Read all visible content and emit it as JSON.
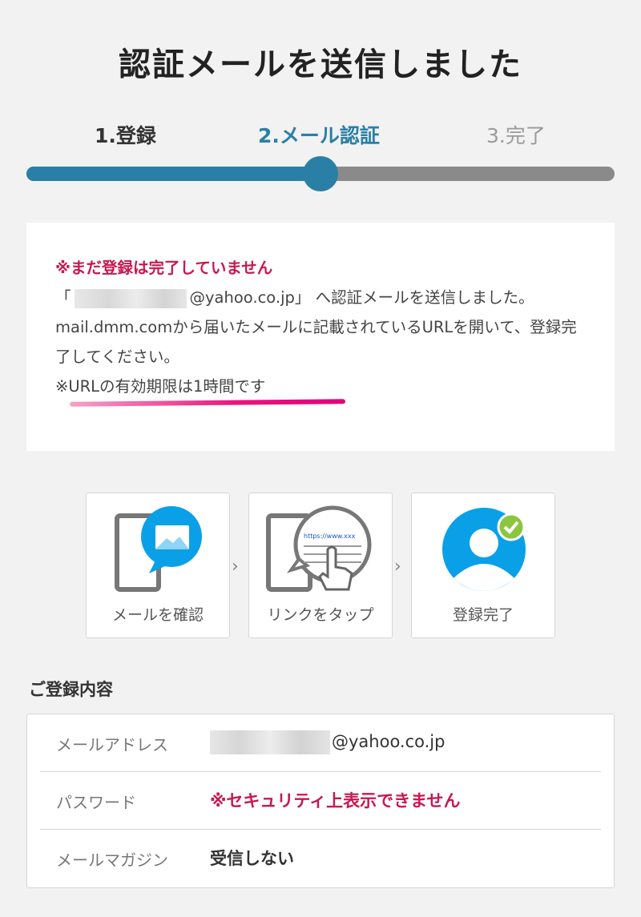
{
  "page": {
    "title": "認証メールを送信しました"
  },
  "steps": {
    "items": [
      {
        "label": "1.登録",
        "state": "done"
      },
      {
        "label": "2.メール認証",
        "state": "current"
      },
      {
        "label": "3.完了",
        "state": "todo"
      }
    ],
    "progress": 0.5,
    "colors": {
      "active": "#2a7fa6",
      "inactive": "#8a8a8a"
    }
  },
  "notice": {
    "warning": "※まだ登録は完了していません",
    "line1_prefix": "「",
    "line1_suffix": "@yahoo.co.jp」 へ認証メールを送信しました。",
    "line2": "mail.dmm.comから届いたメールに記載されているURLを開いて、登録完了してください。",
    "expiry": "※URLの有効期限は1時間です",
    "colors": {
      "warning": "#c8184f",
      "underline": "#e3007a"
    }
  },
  "howto": {
    "cards": [
      {
        "icon": "phone-mail-icon",
        "label": "メールを確認"
      },
      {
        "icon": "phone-tap-link-icon",
        "label": "リンクをタップ"
      },
      {
        "icon": "user-check-icon",
        "label": "登録完了"
      }
    ],
    "arrow": "›",
    "link_snippet": "https://www.xxx"
  },
  "registration": {
    "title": "ご登録内容",
    "rows": [
      {
        "key": "メールアドレス",
        "value": "@yahoo.co.jp",
        "masked": true
      },
      {
        "key": "パスワード",
        "value": "※セキュリティ上表示できません",
        "masked": false
      },
      {
        "key": "メールマガジン",
        "value": "受信しない",
        "masked": false
      }
    ]
  }
}
